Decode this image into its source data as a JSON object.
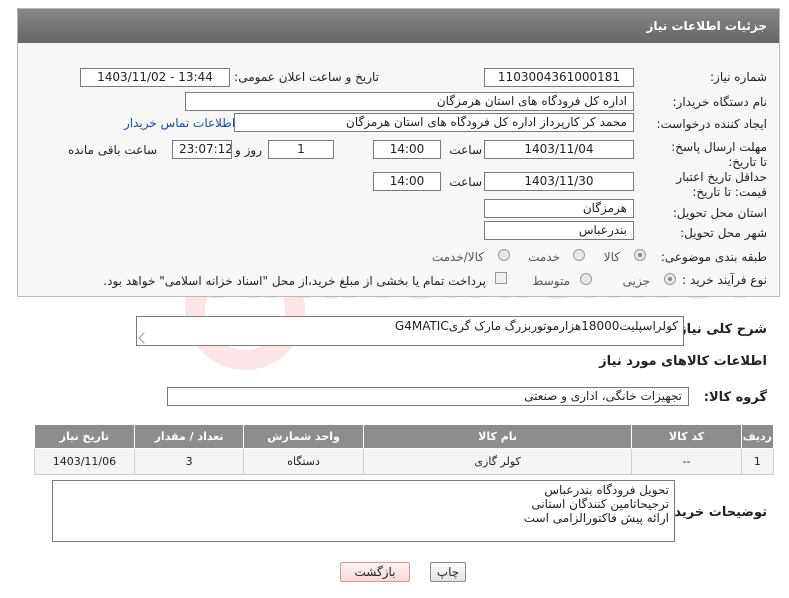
{
  "panel": {
    "title": "جزئیات اطلاعات نیاز"
  },
  "fields": {
    "need_number_label": "شماره نیاز:",
    "need_number": "1103004361000181",
    "announce_label": "تاریخ و ساعت اعلان عمومی:",
    "announce_value": "1403/11/02 - 13:44",
    "buyer_org_label": "نام دستگاه خریدار:",
    "buyer_org": "اداره کل فرودگاه های استان هرمزگان",
    "requester_label": "ایجاد کننده درخواست:",
    "requester": "محمد کر کارپرداز اداره کل فرودگاه های استان هرمزگان",
    "contact_link": "اطلاعات تماس خریدار",
    "deadline_label": "مهلت ارسال پاسخ: تا تاریخ:",
    "deadline_date": "1403/11/04",
    "time_label": "ساعت",
    "deadline_time": "14:00",
    "days_value": "1",
    "days_label": "روز و",
    "remaining_time": "23:07:12",
    "remaining_label": "ساعت باقی مانده",
    "validity_label": "حداقل تاریخ اعتبار قیمت: تا تاریخ:",
    "validity_date": "1403/11/30",
    "validity_time": "14:00",
    "province_label": "استان محل تحویل:",
    "province": "هرمزگان",
    "city_label": "شهر محل تحویل:",
    "city": "بندرعباس",
    "category_label": "طبقه بندی موضوعی:",
    "category_options": [
      "کالا",
      "خدمت",
      "کالا/خدمت"
    ],
    "process_label": "نوع فرآیند خرید :",
    "process_options": [
      "جزیی",
      "متوسط"
    ],
    "payment_note": "پرداخت تمام یا بخشی از مبلغ خرید،از محل \"اسناد خزانه اسلامی\" خواهد بود."
  },
  "description": {
    "label": "شرح کلی نیاز:",
    "value": "کولراسپلیت18000هزارموتوربزرگ مارک گریG4MATIC"
  },
  "goods_info": {
    "title": "اطلاعات کالاهای مورد نیاز"
  },
  "goods_group": {
    "label": "گروه کالا:",
    "value": "تجهیزات خانگی، اداری و صنعتی"
  },
  "table": {
    "headers": [
      "ردیف",
      "کد کالا",
      "نام کالا",
      "واحد شمارش",
      "تعداد / مقدار",
      "تاریخ نیاز"
    ],
    "rows": [
      [
        "1",
        "--",
        "کولر گازی",
        "دستگاه",
        "3",
        "1403/11/06"
      ]
    ]
  },
  "buyer_notes": {
    "label": "توضیحات خریدار:",
    "lines": [
      "تحویل فرودگاه بندرعباس",
      "ترجیحاتامین کنندگان استانی",
      "ارائه پیش فاکتورالزامی است"
    ]
  },
  "buttons": {
    "print": "چاپ",
    "back": "بازگشت"
  },
  "watermark": {
    "text": "AriaTender.neT"
  }
}
